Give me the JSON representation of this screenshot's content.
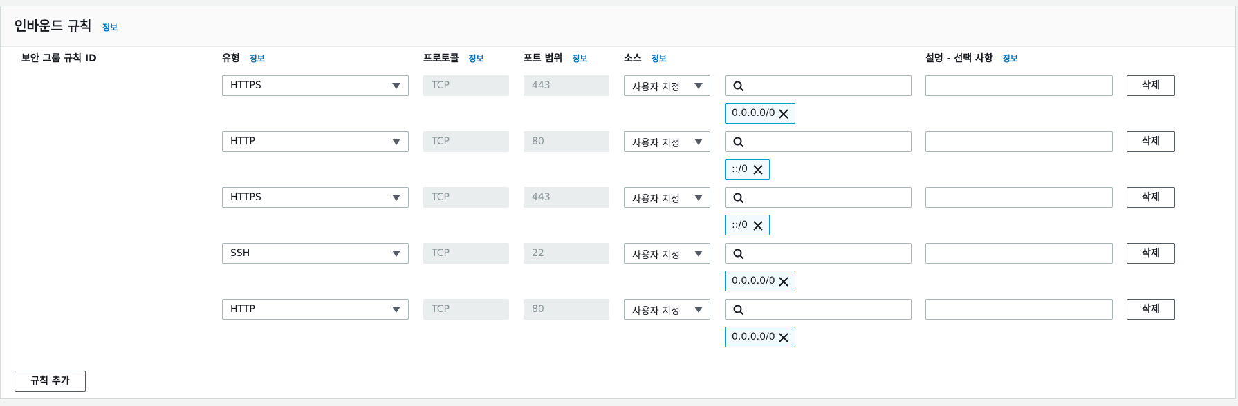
{
  "header": {
    "title": "인바운드 규칙",
    "info": "정보"
  },
  "columns": {
    "rule_id": "보안 그룹 규칙 ID",
    "type": "유형",
    "protocol": "프로토콜",
    "port_range": "포트 범위",
    "source": "소스",
    "description": "설명 - 선택 사항",
    "info": "정보"
  },
  "rules": [
    {
      "type": "HTTPS",
      "protocol": "TCP",
      "port": "443",
      "source_type": "사용자 지정",
      "search_value": "",
      "cidr": "0.0.0.0/0",
      "description": "",
      "delete_label": "삭제"
    },
    {
      "type": "HTTP",
      "protocol": "TCP",
      "port": "80",
      "source_type": "사용자 지정",
      "search_value": "",
      "cidr": "::/0",
      "description": "",
      "delete_label": "삭제"
    },
    {
      "type": "HTTPS",
      "protocol": "TCP",
      "port": "443",
      "source_type": "사용자 지정",
      "search_value": "",
      "cidr": "::/0",
      "description": "",
      "delete_label": "삭제"
    },
    {
      "type": "SSH",
      "protocol": "TCP",
      "port": "22",
      "source_type": "사용자 지정",
      "search_value": "",
      "cidr": "0.0.0.0/0",
      "description": "",
      "delete_label": "삭제"
    },
    {
      "type": "HTTP",
      "protocol": "TCP",
      "port": "80",
      "source_type": "사용자 지정",
      "search_value": "",
      "cidr": "0.0.0.0/0",
      "description": "",
      "delete_label": "삭제"
    }
  ],
  "footer": {
    "add_rule_label": "규칙 추가"
  },
  "colors": {
    "link": "#0073bb",
    "token_border": "#00a1c9",
    "token_bg": "#f1faff",
    "disabled_bg": "#eaeded"
  }
}
